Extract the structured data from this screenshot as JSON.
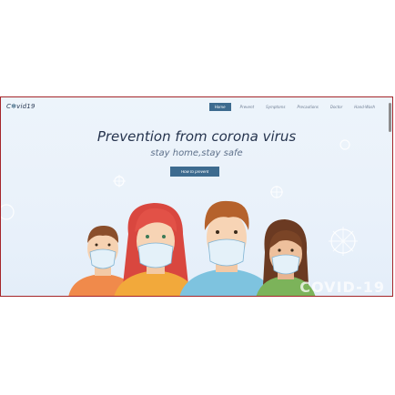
{
  "logo": {
    "prefix": "C",
    "glyph": "✻",
    "suffix": "vid19"
  },
  "nav": {
    "items": [
      {
        "label": "Home",
        "active": true
      },
      {
        "label": "Prevent",
        "active": false
      },
      {
        "label": "Symptoms",
        "active": false
      },
      {
        "label": "Precautions",
        "active": false
      },
      {
        "label": "Doctor",
        "active": false
      },
      {
        "label": "Hand-Wash",
        "active": false
      }
    ]
  },
  "hero": {
    "title": "Prevention from corona virus",
    "subtitle": "stay home,stay safe",
    "cta_label": "How to prevent"
  },
  "decor": {
    "covid_text": "COVID-19"
  },
  "colors": {
    "accent": "#3d6b8f",
    "frame_border": "#a5262a",
    "title": "#26344e"
  }
}
